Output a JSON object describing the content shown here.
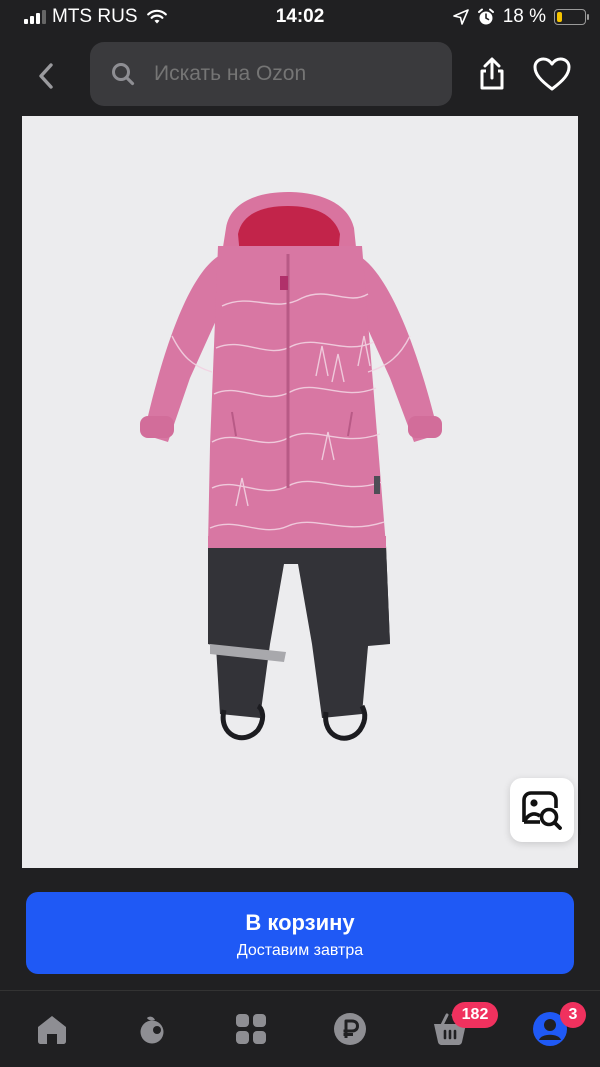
{
  "status_bar": {
    "carrier": "MTS RUS",
    "time": "14:02",
    "battery": "18 %",
    "battery_level": 0.18
  },
  "header": {
    "search_placeholder": "Искать на Ozon",
    "icons": [
      "back-icon",
      "search-icon",
      "share-icon",
      "heart-icon"
    ]
  },
  "product": {
    "image_description_icon": "pink-snowsuit-image",
    "visual_search_icon": "image-search-icon"
  },
  "cart_button": {
    "label": "В корзину",
    "subtitle": "Доставим завтра"
  },
  "tab_bar": {
    "cart_badge": "182",
    "profile_badge": "3",
    "icons": [
      "home-icon",
      "fresh-icon",
      "catalog-icon",
      "ruble-icon",
      "basket-icon",
      "profile-icon"
    ]
  },
  "colors": {
    "accent": "#1f59f5",
    "badge": "#f0315e",
    "background": "#202022"
  }
}
